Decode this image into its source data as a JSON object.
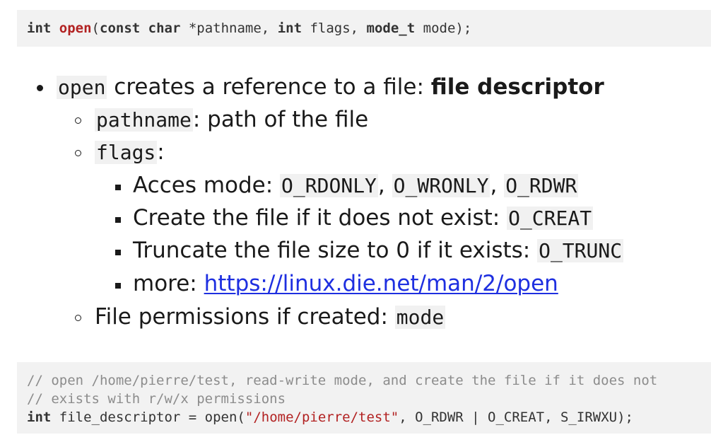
{
  "signature": {
    "return_type": "int",
    "name": "open",
    "open_paren": "(",
    "const_kw": "const",
    "char_kw": "char",
    "param1": " *pathname, ",
    "int_kw": "int",
    "param2": " flags, ",
    "mode_type": "mode_t",
    "param3": " mode);"
  },
  "bullets": {
    "b1": {
      "code": "open",
      "text": " creates a reference to a file: ",
      "bold": "file descriptor"
    },
    "b1_1": {
      "code": "pathname",
      "text": ": path of the file"
    },
    "b1_2": {
      "code": "flags",
      "text": ":"
    },
    "b1_2_1": {
      "text": "Acces mode: ",
      "code1": "O_RDONLY",
      "sep1": ", ",
      "code2": "O_WRONLY",
      "sep2": ", ",
      "code3": "O_RDWR"
    },
    "b1_2_2": {
      "text": "Create the file if it does not exist: ",
      "code": "O_CREAT"
    },
    "b1_2_3": {
      "text": "Truncate the file size to 0 if it exists: ",
      "code": "O_TRUNC"
    },
    "b1_2_4": {
      "text": "more: ",
      "link": "https://linux.die.net/man/2/open"
    },
    "b1_3": {
      "text": "File permissions if created: ",
      "code": "mode"
    }
  },
  "example": {
    "comment1": "// open /home/pierre/test, read-write mode, and create the file if it does not",
    "comment2": "// exists with r/w/x permissions",
    "int_kw": "int",
    "pre": " file_descriptor = open(",
    "path": "\"/home/pierre/test\"",
    "post": ", O_RDWR | O_CREAT, S_IRWXU);"
  }
}
